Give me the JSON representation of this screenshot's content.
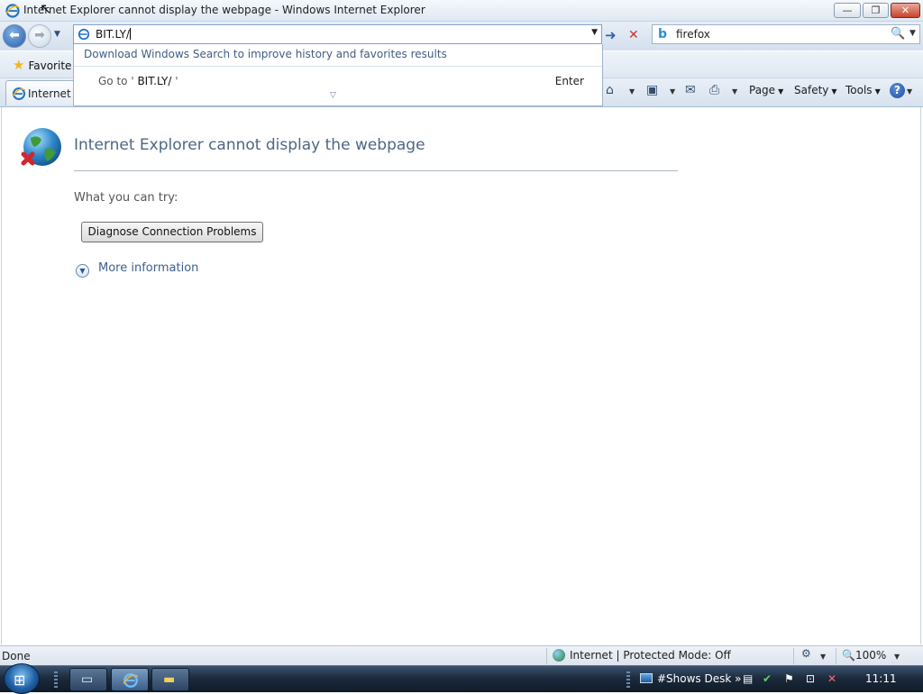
{
  "window": {
    "title": "Internet Explorer cannot display the webpage - Windows Internet Explorer",
    "min_glyph": "—",
    "max_glyph": "❐",
    "close_glyph": "✕"
  },
  "nav": {
    "address_value": "BIT.LY/",
    "search_value": "firefox"
  },
  "dropdown": {
    "windows_search_link": "Download Windows Search to improve history and favorites results",
    "goto_prefix": "Go to '",
    "goto_url": "BIT.LY/",
    "goto_suffix": "'",
    "enter_hint": "Enter"
  },
  "favorites": {
    "label": "Favorite"
  },
  "tab": {
    "label": "Internet E"
  },
  "commands": {
    "page": "Page",
    "safety": "Safety",
    "tools": "Tools",
    "help": "?"
  },
  "error": {
    "title": "Internet Explorer cannot display the webpage",
    "try_label": "What you can try:",
    "diagnose_button": "Diagnose Connection Problems",
    "more_info": "More information"
  },
  "status": {
    "text": "Done",
    "zone": "Internet | Protected Mode: Off",
    "zoom": "100%"
  },
  "taskbar": {
    "desk_label": "#Shows Desk",
    "clock": "11:11"
  },
  "colors": {
    "error_title": "#4e6683",
    "link": "#3d5f8c",
    "taskbar": "#1c2b3d"
  },
  "icons": [
    "ie-icon",
    "back-arrow-icon",
    "forward-arrow-icon",
    "go-arrow-icon",
    "stop-icon",
    "bing-icon",
    "search-icon",
    "favorites-star-icon",
    "home-icon",
    "rss-feeds-icon",
    "read-mail-icon",
    "print-icon",
    "help-icon",
    "globe-error-icon",
    "expand-circle-icon",
    "globe-icon",
    "windows-logo-icon"
  ]
}
